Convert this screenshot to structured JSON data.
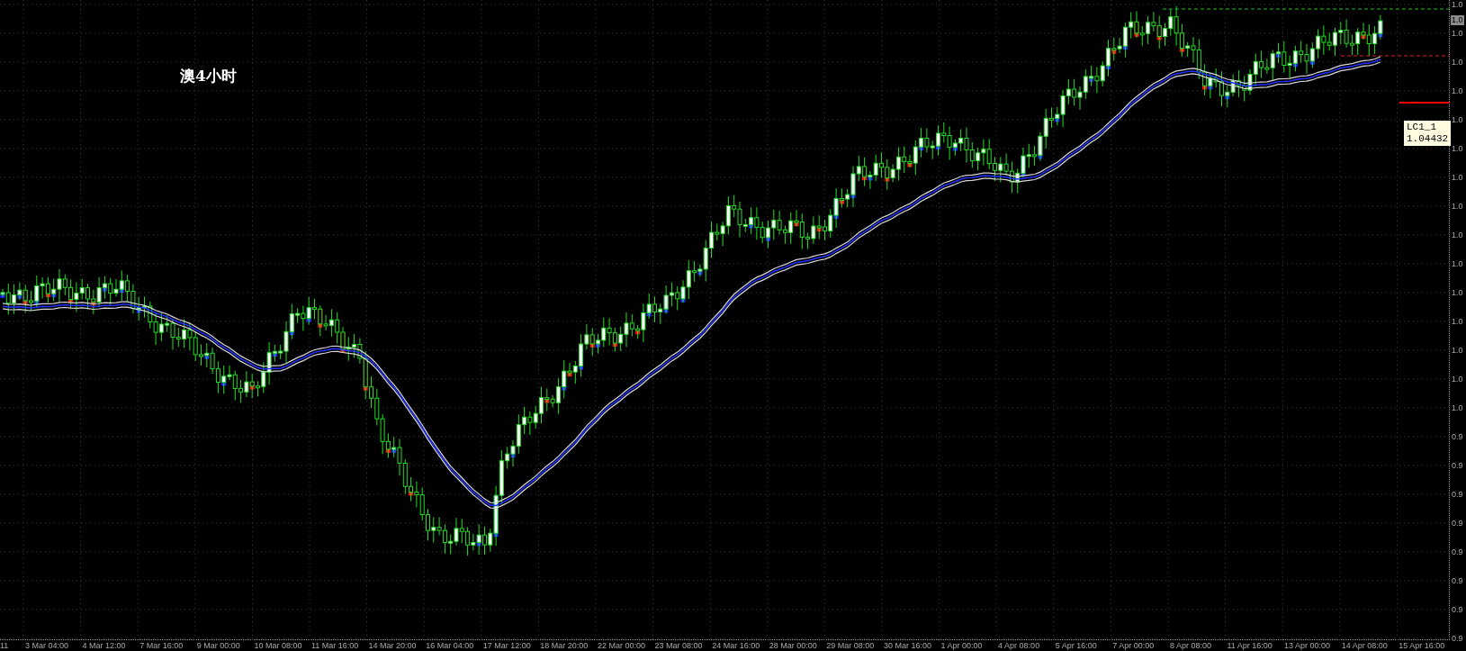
{
  "chart": {
    "title": "澳4小时",
    "price_axis": {
      "current_price": "1.0",
      "labels": [
        "1.0",
        "1.0",
        "1.0",
        "1.0",
        "1.0",
        "1.0",
        "1.0",
        "1.0",
        "1.0",
        "1.0",
        "1.0",
        "1.0",
        "1.0",
        "1.0",
        "1.0",
        "0.9",
        "0.9",
        "0.9",
        "0.9",
        "0.9",
        "0.9",
        "0.9",
        "0.9"
      ]
    },
    "time_axis": {
      "labels": [
        "11",
        "3 Mar 04:00",
        "4 Mar 12:00",
        "7 Mar 16:00",
        "9 Mar 00:00",
        "10 Mar 08:00",
        "11 Mar 16:00",
        "14 Mar 20:00",
        "16 Mar 04:00",
        "17 Mar 12:00",
        "18 Mar 20:00",
        "22 Mar 00:00",
        "23 Mar 08:00",
        "24 Mar 16:00",
        "28 Mar 00:00",
        "29 Mar 08:00",
        "30 Mar 16:00",
        "1 Apr 00:00",
        "4 Apr 08:00",
        "5 Apr 16:00",
        "7 Apr 00:00",
        "8 Apr 08:00",
        "11 Apr 16:00",
        "13 Apr 00:00",
        "14 Apr 08:00",
        "15 Apr 16:00"
      ]
    },
    "line_label": {
      "name": "LC1_1",
      "price": "1.04432"
    }
  }
}
